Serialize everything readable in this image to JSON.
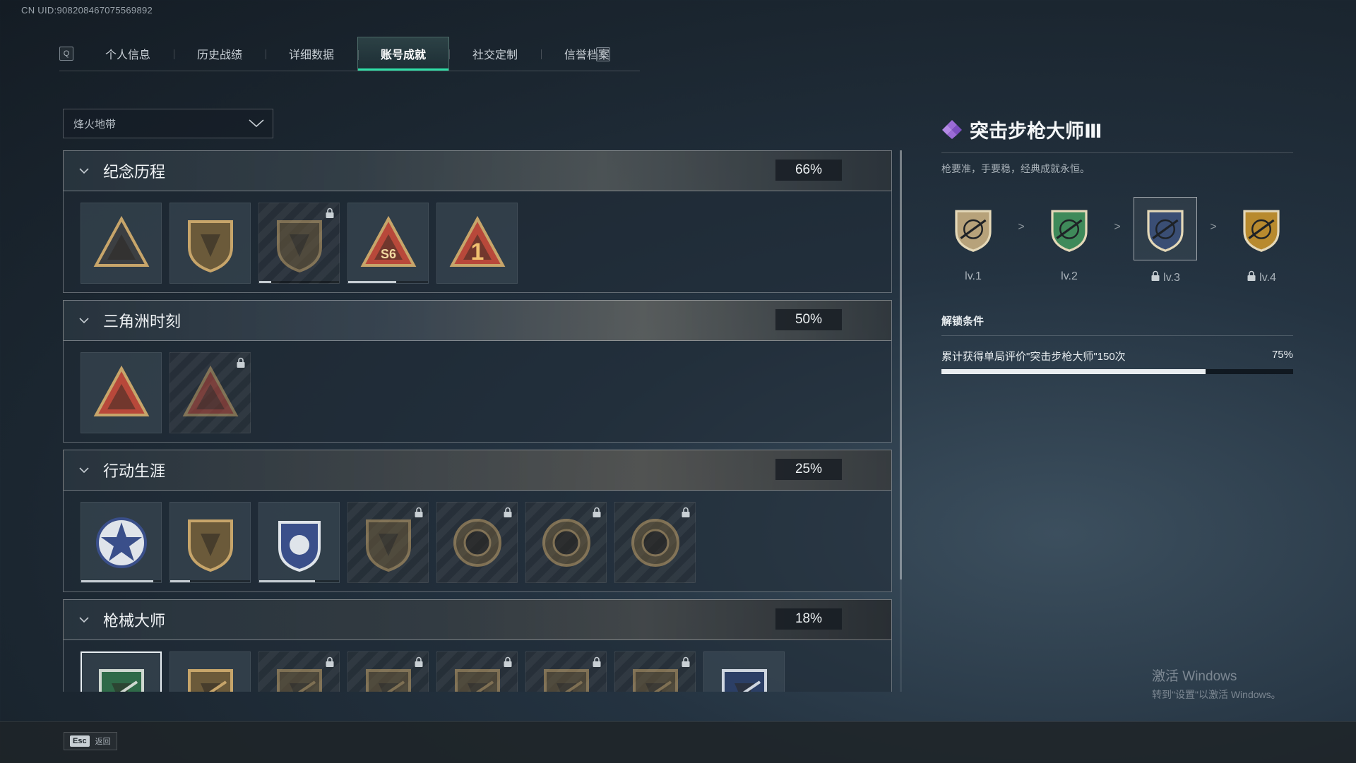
{
  "uid": "CN UID:9082084670755698​92",
  "tabs": {
    "prev_key": "Q",
    "next_key": "E",
    "items": [
      "个人信息",
      "历史战绩",
      "详细数据",
      "账号成就",
      "社交定制",
      "信誉档案"
    ],
    "active_index": 3
  },
  "filter": {
    "selected": "烽火地带"
  },
  "sections": [
    {
      "title": "纪念历程",
      "percent": "66%",
      "medals": [
        {
          "icon": "triangle-badge-icon",
          "locked": false,
          "progress": null
        },
        {
          "icon": "helicopter-badge-icon",
          "locked": false,
          "progress": null
        },
        {
          "icon": "shield-emblem-icon",
          "locked": true,
          "progress": 0.15
        },
        {
          "icon": "s6-triangle-icon",
          "locked": false,
          "progress": 0.6
        },
        {
          "icon": "number-one-triangle-icon",
          "locked": false,
          "progress": null
        }
      ]
    },
    {
      "title": "三角洲时刻",
      "percent": "50%",
      "medals": [
        {
          "icon": "triangle-tower-icon",
          "locked": false,
          "progress": null
        },
        {
          "icon": "triangle-figure-icon",
          "locked": true,
          "progress": null
        }
      ]
    },
    {
      "title": "行动生涯",
      "percent": "25%",
      "medals": [
        {
          "icon": "star-crest-icon",
          "locked": false,
          "progress": 0.9
        },
        {
          "icon": "shield-fist-icon",
          "locked": false,
          "progress": 0.25
        },
        {
          "icon": "police-crest-icon",
          "locked": false,
          "progress": 0.7
        },
        {
          "icon": "hexagon-shield-icon",
          "locked": true,
          "progress": null
        },
        {
          "icon": "helmet-circle-icon",
          "locked": true,
          "progress": null
        },
        {
          "icon": "skull-circle-icon",
          "locked": true,
          "progress": null
        },
        {
          "icon": "eye-circle-icon",
          "locked": true,
          "progress": null
        }
      ]
    },
    {
      "title": "枪械大师",
      "percent": "18%",
      "medals": [
        {
          "icon": "rifle-shield-green-icon",
          "locked": false,
          "selected": true,
          "progress": null
        },
        {
          "icon": "rifle-shield-icon",
          "locked": false,
          "progress": null
        },
        {
          "icon": "rifle-shield-icon",
          "locked": true,
          "progress": null
        },
        {
          "icon": "rifle-shield-icon",
          "locked": true,
          "progress": null
        },
        {
          "icon": "rifle-shield-icon",
          "locked": true,
          "progress": null
        },
        {
          "icon": "rifle-shield-icon",
          "locked": true,
          "progress": null
        },
        {
          "icon": "rifle-shield-icon",
          "locked": true,
          "progress": null
        },
        {
          "icon": "rifle-shield-blue-icon",
          "locked": false,
          "progress": null
        }
      ]
    }
  ],
  "detail": {
    "title": "突击步枪大师Ⅲ",
    "description": "枪要准，手要稳，经典成就永恒。",
    "levels": [
      {
        "label": "lv.1",
        "locked": false,
        "color": "#b7a27a"
      },
      {
        "label": "lv.2",
        "locked": false,
        "color": "#3f8a5a"
      },
      {
        "label": "lv.3",
        "locked": true,
        "color": "#3a4e74",
        "current": true
      },
      {
        "label": "lv.4",
        "locked": true,
        "color": "#b88a2e"
      }
    ],
    "arrow": ">",
    "unlock_title": "解锁条件",
    "condition": "累计获得单局评价\"突击步枪大师\"150次",
    "condition_percent": "75%",
    "condition_progress": 0.75
  },
  "watermark": {
    "line1": "激活 Windows",
    "line2": "转到\"设置\"以激活 Windows。"
  },
  "footer": {
    "key": "Esc",
    "label": "返回"
  },
  "colors": {
    "accent": "#2fe0a8",
    "gem": "#9b6bd6"
  }
}
